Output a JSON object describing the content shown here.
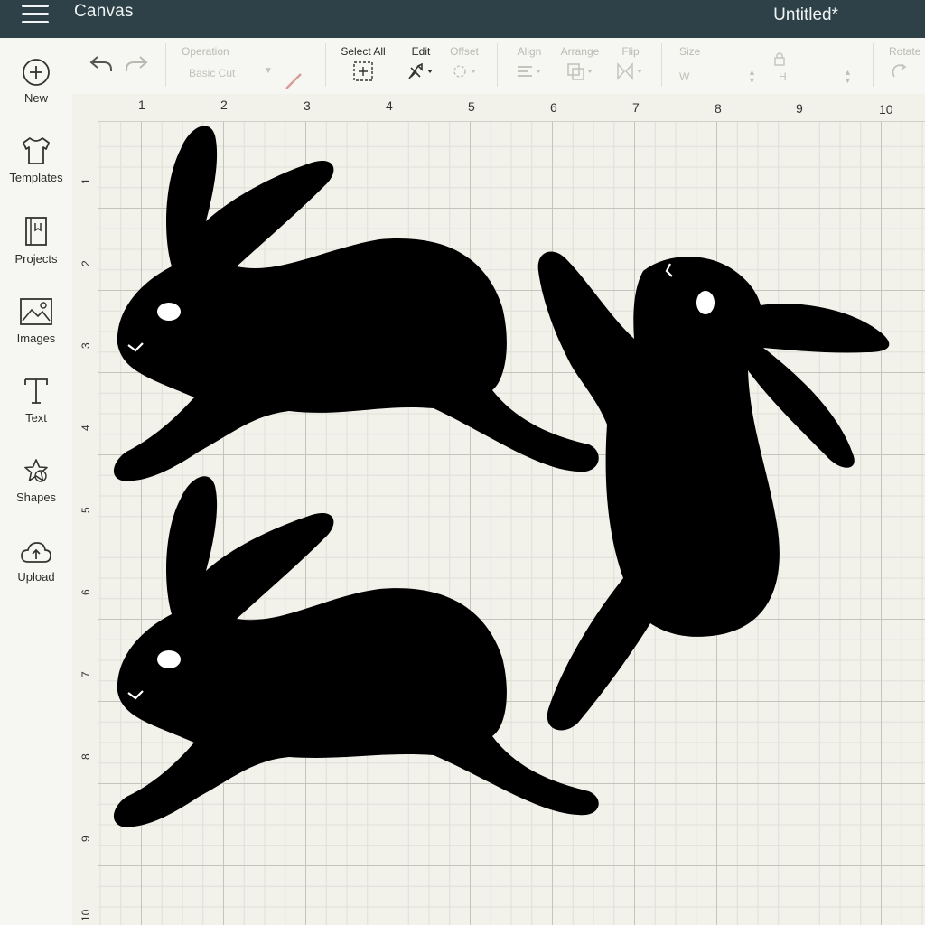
{
  "header": {
    "app_title": "Canvas",
    "doc_title": "Untitled*"
  },
  "sidebar": {
    "items": [
      {
        "label": "New",
        "icon": "plus-circle-icon"
      },
      {
        "label": "Templates",
        "icon": "tshirt-icon"
      },
      {
        "label": "Projects",
        "icon": "notebook-icon"
      },
      {
        "label": "Images",
        "icon": "image-icon"
      },
      {
        "label": "Text",
        "icon": "text-icon"
      },
      {
        "label": "Shapes",
        "icon": "shapes-icon"
      },
      {
        "label": "Upload",
        "icon": "cloud-upload-icon"
      }
    ]
  },
  "toolbar": {
    "operation_label": "Operation",
    "operation_value": "Basic Cut",
    "select_all_label": "Select All",
    "edit_label": "Edit",
    "offset_label": "Offset",
    "align_label": "Align",
    "arrange_label": "Arrange",
    "flip_label": "Flip",
    "size_label": "Size",
    "width_prefix": "W",
    "height_prefix": "H",
    "rotate_label": "Rotate"
  },
  "ruler": {
    "top": [
      "1",
      "2",
      "3",
      "4",
      "5",
      "6",
      "7",
      "8",
      "9",
      "10"
    ],
    "left": [
      "1",
      "2",
      "3",
      "4",
      "5",
      "6",
      "7",
      "8",
      "9",
      "10"
    ]
  },
  "colors": {
    "topbar": "#2f4148",
    "shape_fill": "#000000",
    "canvas_bg": "#f2f1ea",
    "cut_line": "#d99a9a"
  }
}
